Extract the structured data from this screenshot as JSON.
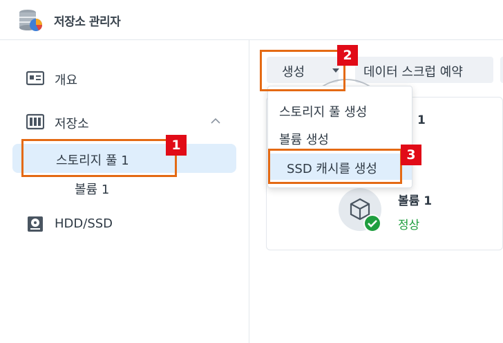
{
  "window": {
    "title": "저장소 관리자",
    "app_icon": "storage-manager-icon"
  },
  "sidebar": {
    "items": [
      {
        "label": "개요",
        "icon": "overview-icon"
      },
      {
        "label": "저장소",
        "icon": "storage-icon",
        "expanded": true
      },
      {
        "label": "스토리지 풀 1",
        "selected": true
      },
      {
        "label": "볼륨 1"
      },
      {
        "label": "HDD/SSD",
        "icon": "disk-icon"
      }
    ]
  },
  "toolbar": {
    "create_label": "생성",
    "scrub_label": "데이터 스크럽 예약"
  },
  "create_menu": {
    "items": [
      {
        "label": "스토리지 풀 생성"
      },
      {
        "label": "볼륨 생성"
      },
      {
        "label": "SSD 캐시를 생성",
        "highlighted": true
      }
    ]
  },
  "content": {
    "pool_number": "1",
    "volume_name": "볼륨 1",
    "volume_status": "정상",
    "status_color": "#1f9e3f"
  },
  "callouts": [
    {
      "number": "1"
    },
    {
      "number": "2"
    },
    {
      "number": "3"
    }
  ],
  "colors": {
    "accent": "#e46a14",
    "badge": "#e10b17",
    "selected_bg": "#dfeefc"
  }
}
